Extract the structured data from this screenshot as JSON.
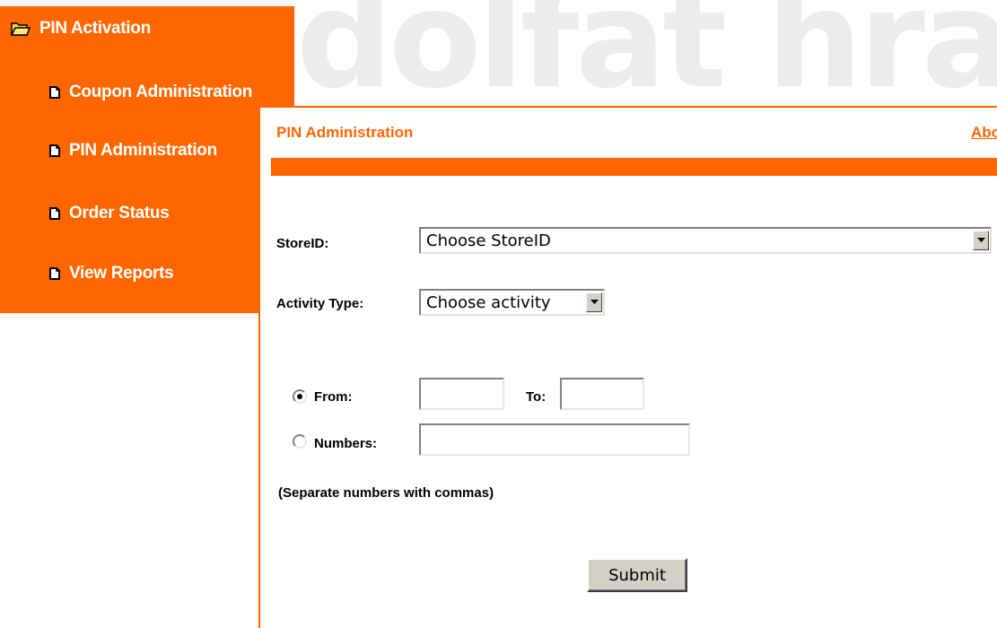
{
  "colors": {
    "accent": "#ff6600",
    "button_face": "#d4d0c8"
  },
  "sidebar": {
    "root": {
      "label": "PIN Activation",
      "icon": "folder-open-icon"
    },
    "items": [
      {
        "label": "Coupon Administration",
        "icon": "document-icon"
      },
      {
        "label": "PIN Administration",
        "icon": "document-icon"
      },
      {
        "label": "Order Status",
        "icon": "document-icon"
      },
      {
        "label": "View Reports",
        "icon": "document-icon"
      }
    ]
  },
  "panel": {
    "title": "PIN Administration",
    "about_link": "About",
    "store_label": "StoreID:",
    "store_select_value": "Choose StoreID",
    "activity_label": "Activity Type:",
    "activity_select_value": "Choose activity",
    "from_label": "From:",
    "to_label": "To:",
    "numbers_label": "Numbers:",
    "range_mode_selected": "From",
    "from_value": "",
    "to_value": "",
    "numbers_value": "",
    "note": "(Separate numbers with commas)",
    "submit_label": "Submit"
  }
}
